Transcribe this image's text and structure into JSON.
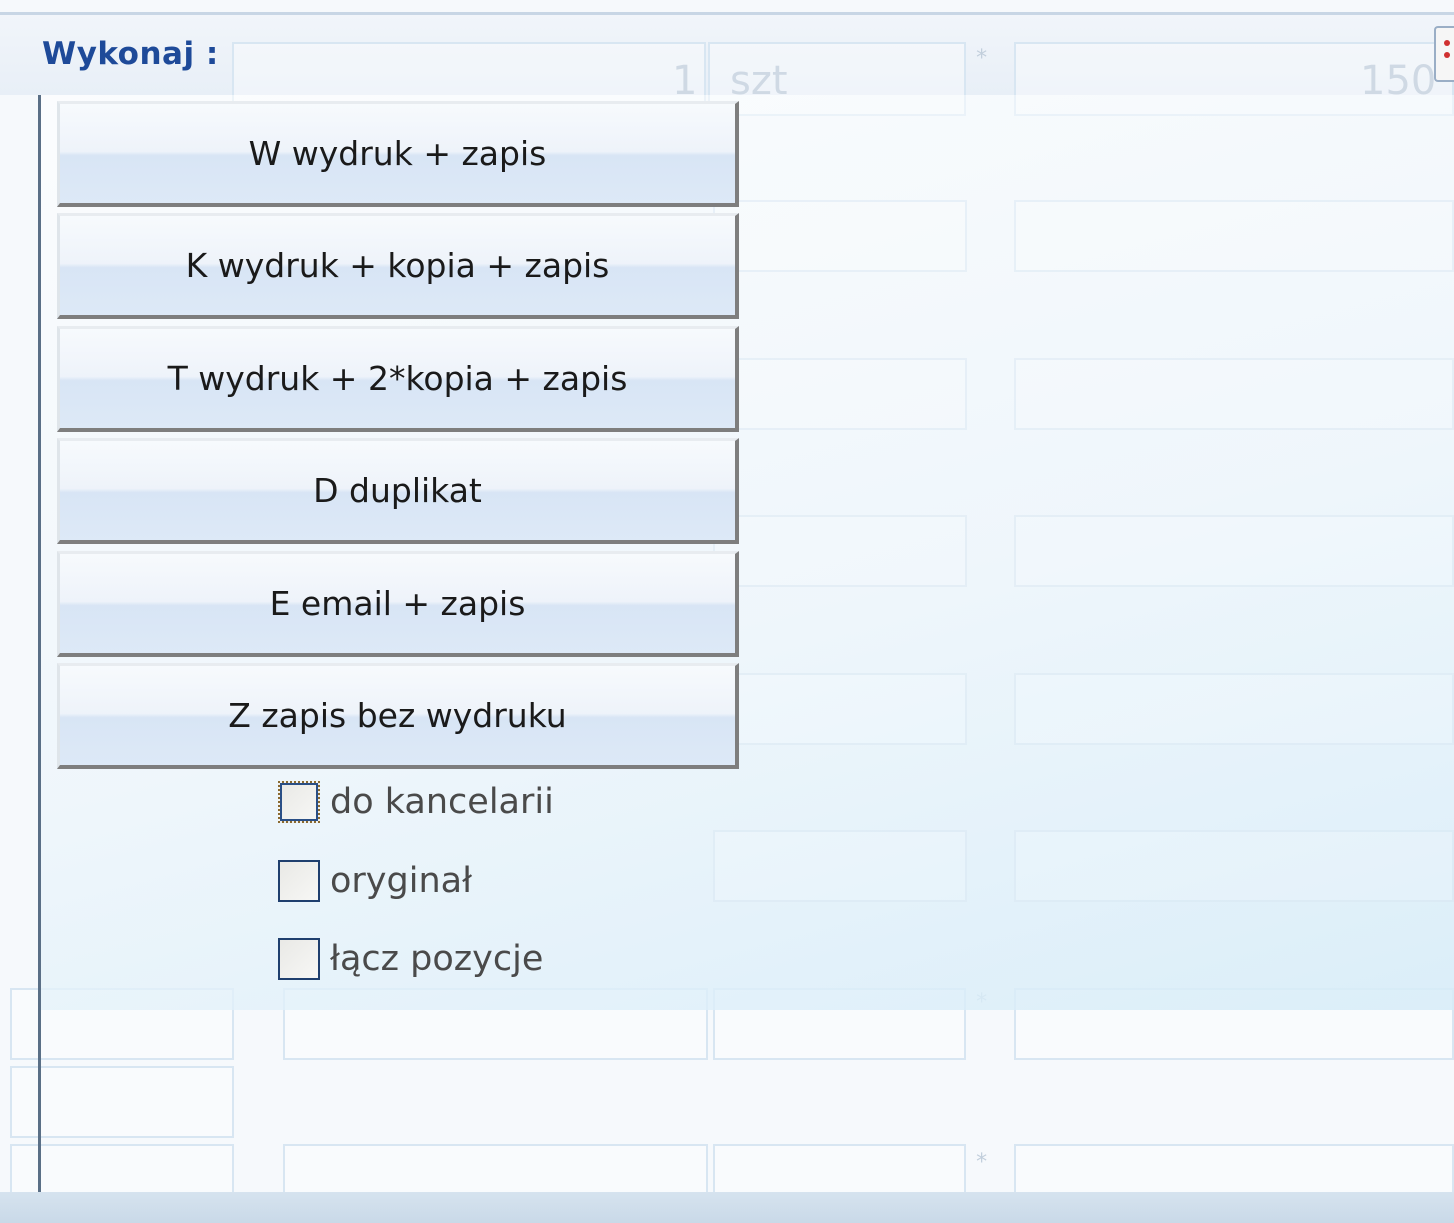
{
  "window": {
    "title": "Wykonaj :"
  },
  "background_form": {
    "quantity_value": "1",
    "unit_value": "szt",
    "price_value_partial": "150",
    "multiply_sign": "*"
  },
  "actions": [
    {
      "key": "W",
      "label": "W wydruk + zapis"
    },
    {
      "key": "K",
      "label": "K wydruk + kopia + zapis"
    },
    {
      "key": "T",
      "label": "T wydruk + 2*kopia + zapis"
    },
    {
      "key": "D",
      "label": "D duplikat"
    },
    {
      "key": "E",
      "label": "E email + zapis"
    },
    {
      "key": "Z",
      "label": "Z zapis bez wydruku"
    }
  ],
  "options": [
    {
      "label": "do kancelarii",
      "checked": false,
      "focused": true
    },
    {
      "label": "oryginał",
      "checked": false,
      "focused": false
    },
    {
      "label": "łącz pozycje",
      "checked": false,
      "focused": false
    }
  ],
  "colors": {
    "title": "#1e4a99",
    "button_text": "#1a1a1a",
    "checkbox_border": "#1f3f6e"
  }
}
